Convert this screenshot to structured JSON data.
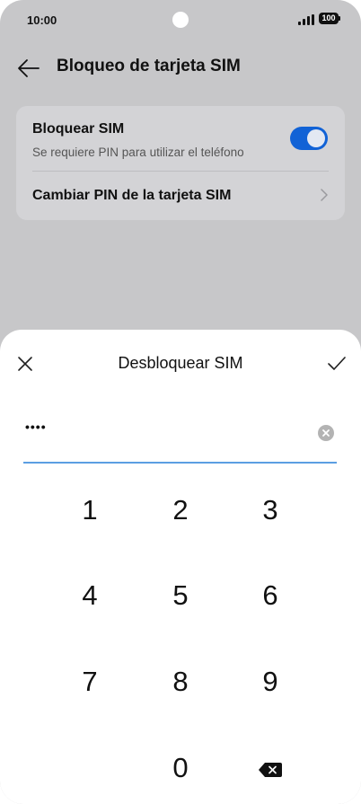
{
  "status_bar": {
    "time": "10:00",
    "battery": "100"
  },
  "header": {
    "title": "Bloqueo de tarjeta SIM",
    "back_icon": "arrow-left-icon"
  },
  "settings": {
    "lock_sim": {
      "title": "Bloquear SIM",
      "subtitle": "Se requiere PIN para utilizar el teléfono",
      "enabled": true
    },
    "change_pin": {
      "title": "Cambiar PIN de la tarjeta SIM"
    }
  },
  "dialog": {
    "title": "Desbloquear SIM",
    "close_icon": "close-icon",
    "confirm_icon": "checkmark-icon",
    "pin_value": "••••"
  },
  "keypad": {
    "keys": [
      "1",
      "2",
      "3",
      "4",
      "5",
      "6",
      "7",
      "8",
      "9",
      "0"
    ],
    "backspace_icon": "backspace-icon"
  },
  "colors": {
    "accent": "#1162d6",
    "input_underline": "#5b9ee2",
    "scrim_background": "#c7c7c9",
    "card_background": "#d3d3d6"
  }
}
